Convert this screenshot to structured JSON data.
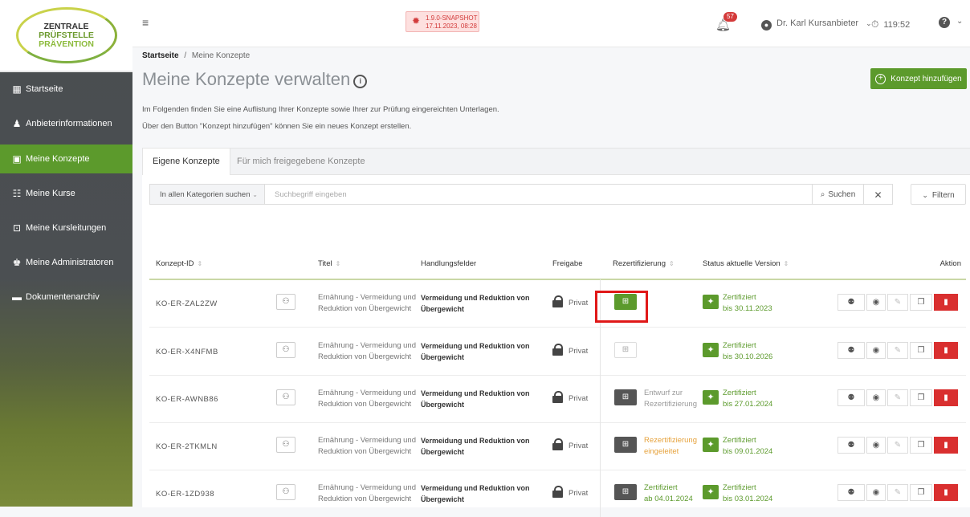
{
  "logo": {
    "line1": "ZENTRALE",
    "line2": "PRÜFSTELLE",
    "line3": "PRÄVENTION"
  },
  "sidebar": {
    "items": [
      {
        "label": "Startseite",
        "icon": "dashboard-icon",
        "active": false
      },
      {
        "label": "Anbieterinformationen",
        "icon": "provider-icon",
        "active": false
      },
      {
        "label": "Meine Konzepte",
        "icon": "concepts-icon",
        "active": true
      },
      {
        "label": "Meine Kurse",
        "icon": "courses-icon",
        "active": false
      },
      {
        "label": "Meine Kursleitungen",
        "icon": "instructors-icon",
        "active": false
      },
      {
        "label": "Meine Administratoren",
        "icon": "admins-icon",
        "active": false
      },
      {
        "label": "Dokumentenarchiv",
        "icon": "archive-icon",
        "active": false
      }
    ]
  },
  "topbar": {
    "snapshot_version": "1.9.0-SNAPSHOT",
    "snapshot_date": "17.11.2023, 08:28",
    "notification_count": "57",
    "user_name": "Dr. Karl Kursanbieter",
    "session_timer": "119:52"
  },
  "breadcrumb": {
    "home": "Startseite",
    "separator": "/",
    "current": "Meine Konzepte"
  },
  "page": {
    "title": "Meine Konzepte verwalten",
    "add_button": "Konzept hinzufügen",
    "intro_line1": "Im Folgenden finden Sie eine Auflistung Ihrer Konzepte sowie Ihrer zur Prüfung eingereichten Unterlagen.",
    "intro_line2": "Über den Button \"Konzept hinzufügen\" können Sie ein neues Konzept erstellen."
  },
  "tabs": [
    {
      "label": "Eigene Konzepte",
      "active": true
    },
    {
      "label": "Für mich freigegebene Konzepte",
      "active": false
    }
  ],
  "search": {
    "category": "In allen Kategorien suchen",
    "placeholder": "Suchbegriff eingeben",
    "search_label": "Suchen",
    "filter_label": "Filtern"
  },
  "table": {
    "headers": {
      "id": "Konzept-ID",
      "title": "Titel",
      "fields": "Handlungsfelder",
      "share": "Freigabe",
      "recert": "Rezertifizierung",
      "status": "Status aktuelle Version",
      "action": "Aktion"
    },
    "rows": [
      {
        "id": "KO-ER-ZAL2ZW",
        "title1": "Ernährung - Vermeidung und",
        "title2": "Reduktion von Übergewicht",
        "field1": "Vermeidung und Reduktion von",
        "field2": "Übergewicht",
        "share": "Privat",
        "recert_state": "green",
        "recert1": "",
        "recert2": "",
        "recert_color": "gray",
        "status1": "Zertifiziert",
        "status2": "bis 30.11.2023"
      },
      {
        "id": "KO-ER-X4NFMB",
        "title1": "Ernährung - Vermeidung und",
        "title2": "Reduktion von Übergewicht",
        "field1": "Vermeidung und Reduktion von",
        "field2": "Übergewicht",
        "share": "Privat",
        "recert_state": "light",
        "recert1": "",
        "recert2": "",
        "recert_color": "gray",
        "status1": "Zertifiziert",
        "status2": "bis 30.10.2026"
      },
      {
        "id": "KO-ER-AWNB86",
        "title1": "Ernährung - Vermeidung und",
        "title2": "Reduktion von Übergewicht",
        "field1": "Vermeidung und Reduktion von",
        "field2": "Übergewicht",
        "share": "Privat",
        "recert_state": "dark",
        "recert1": "Entwurf zur",
        "recert2": "Rezertifizierung",
        "recert_color": "gray",
        "status1": "Zertifiziert",
        "status2": "bis 27.01.2024"
      },
      {
        "id": "KO-ER-2TKMLN",
        "title1": "Ernährung - Vermeidung und",
        "title2": "Reduktion von Übergewicht",
        "field1": "Vermeidung und Reduktion von",
        "field2": "Übergewicht",
        "share": "Privat",
        "recert_state": "dark",
        "recert1": "Rezertifizierung",
        "recert2": "eingeleitet",
        "recert_color": "orange",
        "status1": "Zertifiziert",
        "status2": "bis 09.01.2024"
      },
      {
        "id": "KO-ER-1ZD938",
        "title1": "Ernährung - Vermeidung und",
        "title2": "Reduktion von Übergewicht",
        "field1": "Vermeidung und Reduktion von",
        "field2": "Übergewicht",
        "share": "Privat",
        "recert_state": "dark",
        "recert1": "Zertifiziert",
        "recert2": "ab 04.01.2024",
        "recert_color": "green",
        "status1": "Zertifiziert",
        "status2": "bis 03.01.2024"
      }
    ]
  },
  "colors": {
    "accent": "#5c9a2c",
    "danger": "#d92f2f",
    "highlight": "#e01818"
  }
}
